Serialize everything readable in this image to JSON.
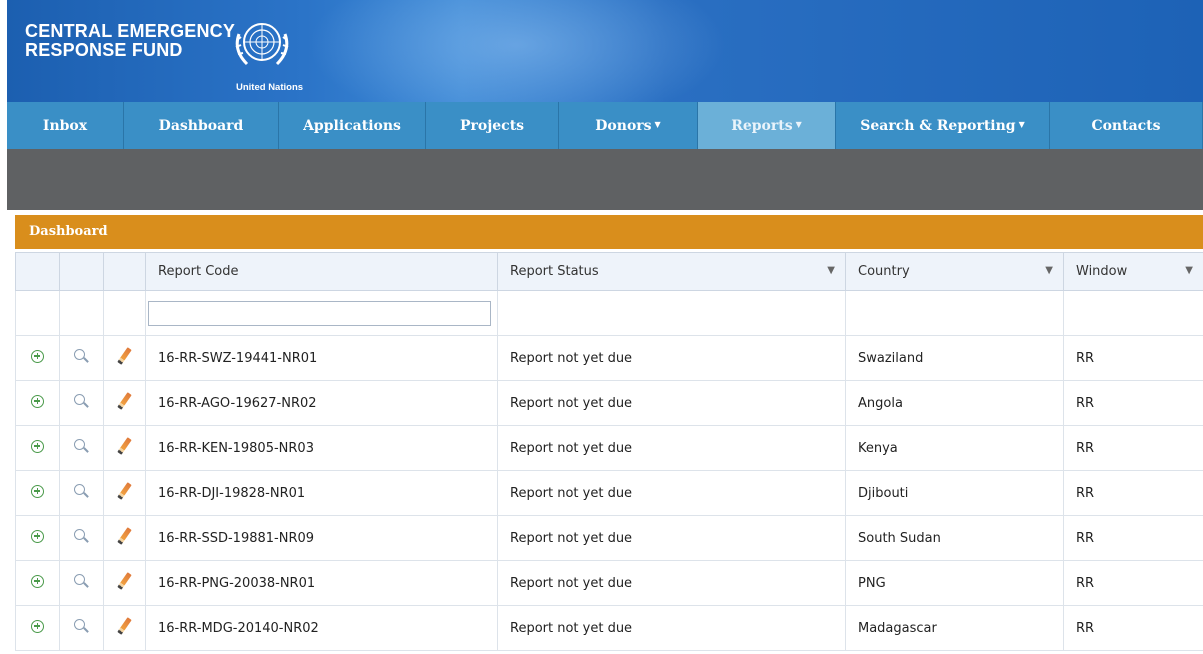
{
  "brand": {
    "line1": "CENTRAL EMERGENCY",
    "line2": "RESPONSE FUND",
    "org": "United Nations"
  },
  "nav": [
    {
      "label": "Inbox",
      "dropdown": false,
      "active": false
    },
    {
      "label": "Dashboard",
      "dropdown": false,
      "active": false
    },
    {
      "label": "Applications",
      "dropdown": false,
      "active": false
    },
    {
      "label": "Projects",
      "dropdown": false,
      "active": false
    },
    {
      "label": "Donors",
      "dropdown": true,
      "active": false
    },
    {
      "label": "Reports",
      "dropdown": true,
      "active": true
    },
    {
      "label": "Search & Reporting",
      "dropdown": true,
      "active": false
    },
    {
      "label": "Contacts",
      "dropdown": false,
      "active": false
    }
  ],
  "panel": {
    "title": "Dashboard"
  },
  "table": {
    "columns": [
      "Report Code",
      "Report Status",
      "Country",
      "Window"
    ],
    "filter": {
      "report_code": ""
    },
    "row_icons": [
      "expand-icon",
      "view-icon",
      "edit-icon"
    ],
    "rows": [
      {
        "code": "16-RR-SWZ-19441-NR01",
        "status": "Report not yet due",
        "country": "Swaziland",
        "window": "RR"
      },
      {
        "code": "16-RR-AGO-19627-NR02",
        "status": "Report not yet due",
        "country": "Angola",
        "window": "RR"
      },
      {
        "code": "16-RR-KEN-19805-NR03",
        "status": "Report not yet due",
        "country": "Kenya",
        "window": "RR"
      },
      {
        "code": "16-RR-DJI-19828-NR01",
        "status": "Report not yet due",
        "country": "Djibouti",
        "window": "RR"
      },
      {
        "code": "16-RR-SSD-19881-NR09",
        "status": "Report not yet due",
        "country": "South Sudan",
        "window": "RR"
      },
      {
        "code": "16-RR-PNG-20038-NR01",
        "status": "Report not yet due",
        "country": "PNG",
        "window": "RR"
      },
      {
        "code": "16-RR-MDG-20140-NR02",
        "status": "Report not yet due",
        "country": "Madagascar",
        "window": "RR"
      }
    ]
  },
  "colors": {
    "header_blue": "#1a64b8",
    "nav_blue": "#3a8fc6",
    "nav_active": "#6bb0d8",
    "panel_orange": "#d98e1c",
    "band_gray": "#5f6163"
  }
}
